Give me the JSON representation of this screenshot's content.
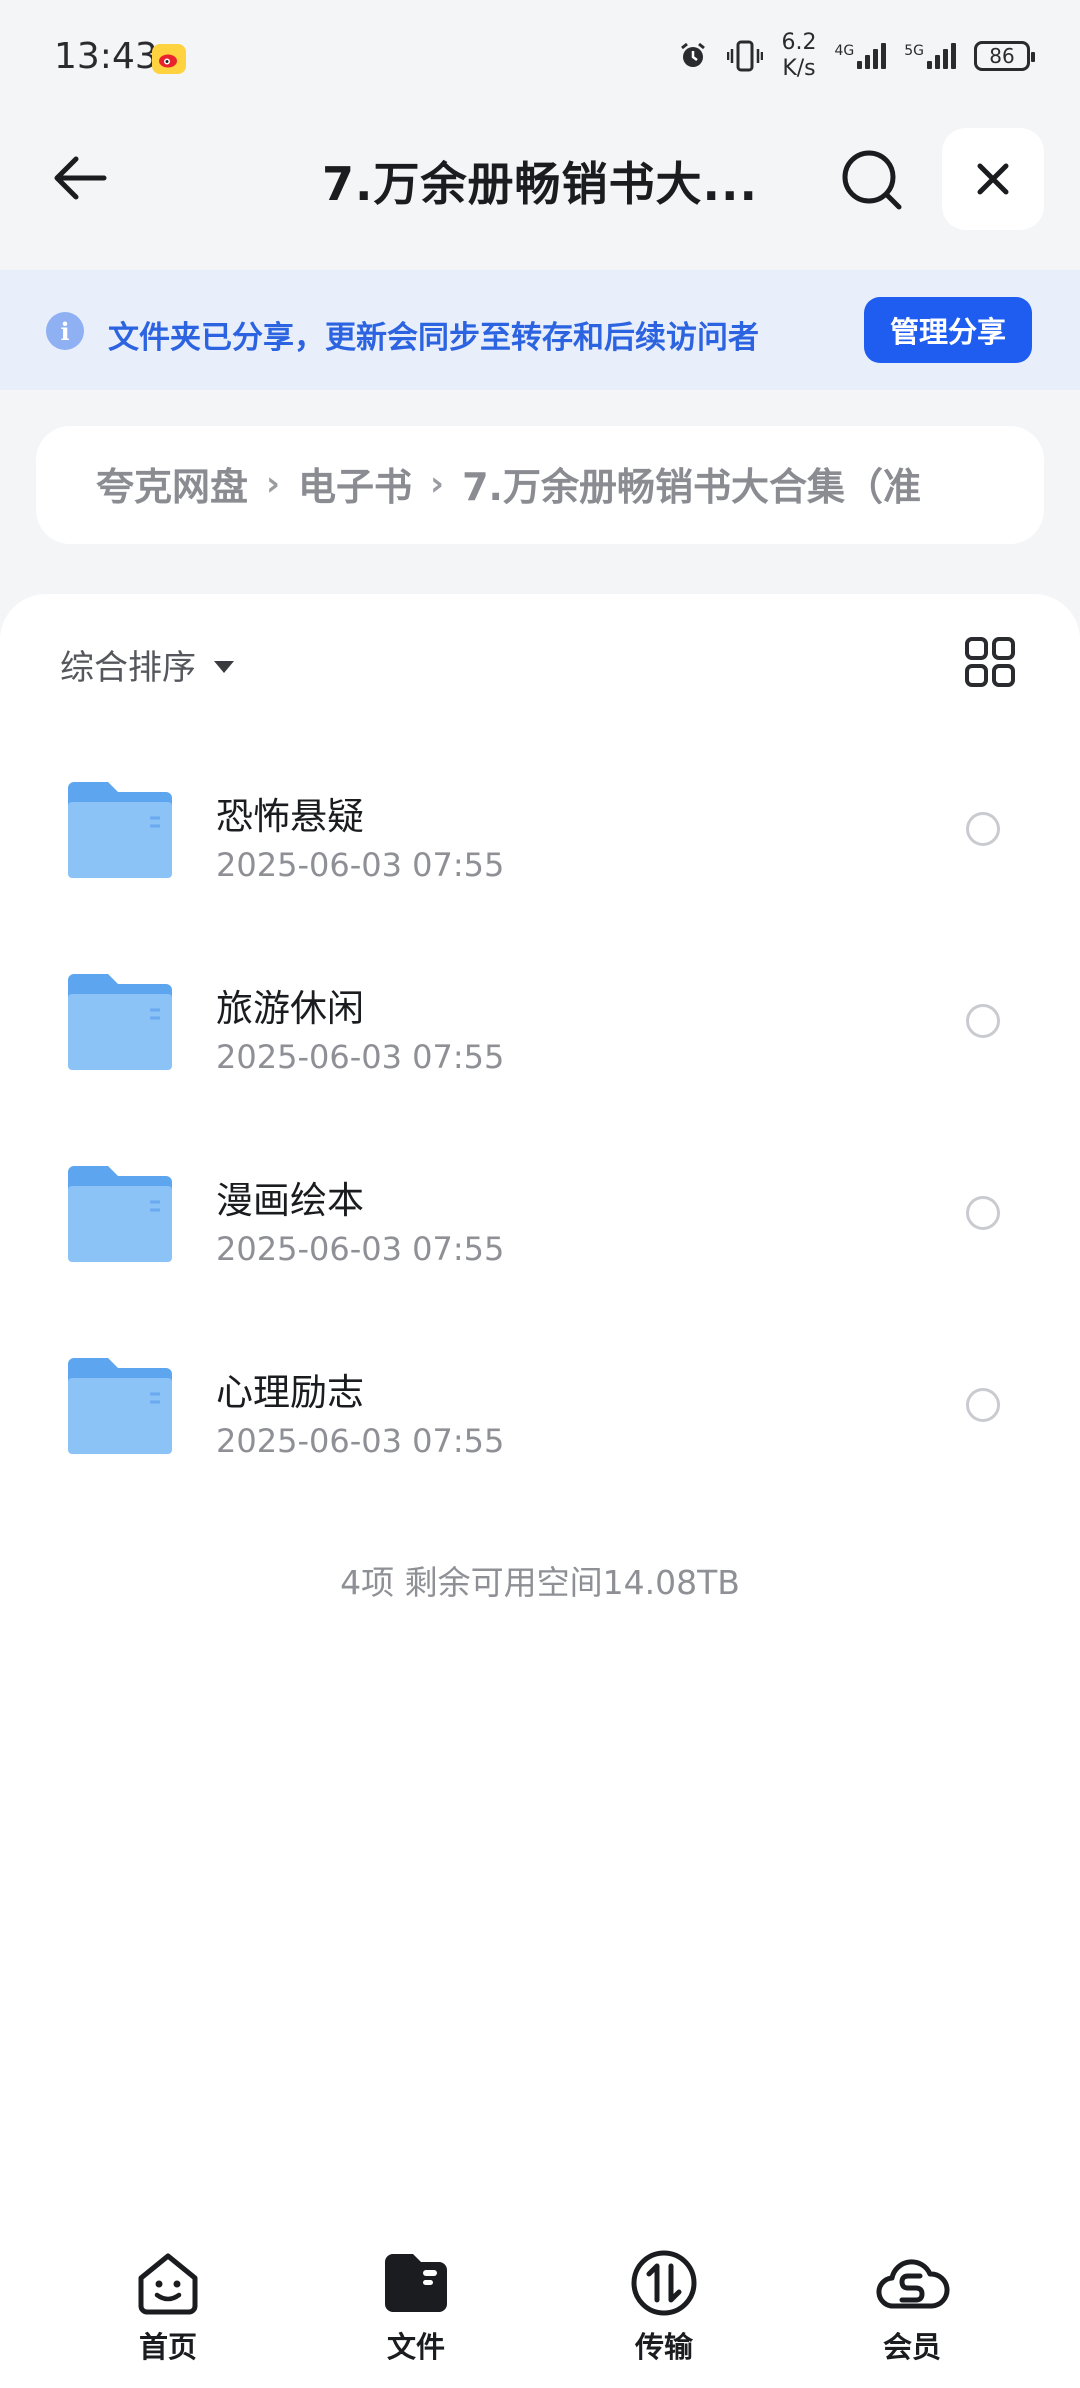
{
  "status_bar": {
    "time": "13:43",
    "speed_value": "6.2",
    "speed_unit": "K/s",
    "network1": "4G",
    "network2": "5G",
    "battery": "86"
  },
  "header": {
    "title": "7.万余册畅销书大...",
    "back_icon": "arrow-left-icon",
    "search_icon": "search-icon",
    "close_icon": "close-icon"
  },
  "banner": {
    "text": "文件夹已分享，更新会同步至转存和后续访问者",
    "button": "管理分享"
  },
  "breadcrumb": {
    "items": [
      "夸克网盘",
      "电子书",
      "7.万余册畅销书大合集（准"
    ]
  },
  "toolbar": {
    "sort_label": "综合排序"
  },
  "files": [
    {
      "name": "恐怖悬疑",
      "date": "2025-06-03 07:55"
    },
    {
      "name": "旅游休闲",
      "date": "2025-06-03 07:55"
    },
    {
      "name": "漫画绘本",
      "date": "2025-06-03 07:55"
    },
    {
      "name": "心理励志",
      "date": "2025-06-03 07:55"
    }
  ],
  "footer_note": "4项 剩余可用空间14.08TB",
  "bottom_nav": [
    {
      "label": "首页",
      "icon": "smiley-home-icon"
    },
    {
      "label": "文件",
      "icon": "folder-icon"
    },
    {
      "label": "传输",
      "icon": "transfer-icon"
    },
    {
      "label": "会员",
      "icon": "cloud-member-icon"
    }
  ],
  "colors": {
    "accent": "#1f5cf0",
    "banner_bg": "#e9eefb",
    "folder": "#6fb1f4"
  }
}
